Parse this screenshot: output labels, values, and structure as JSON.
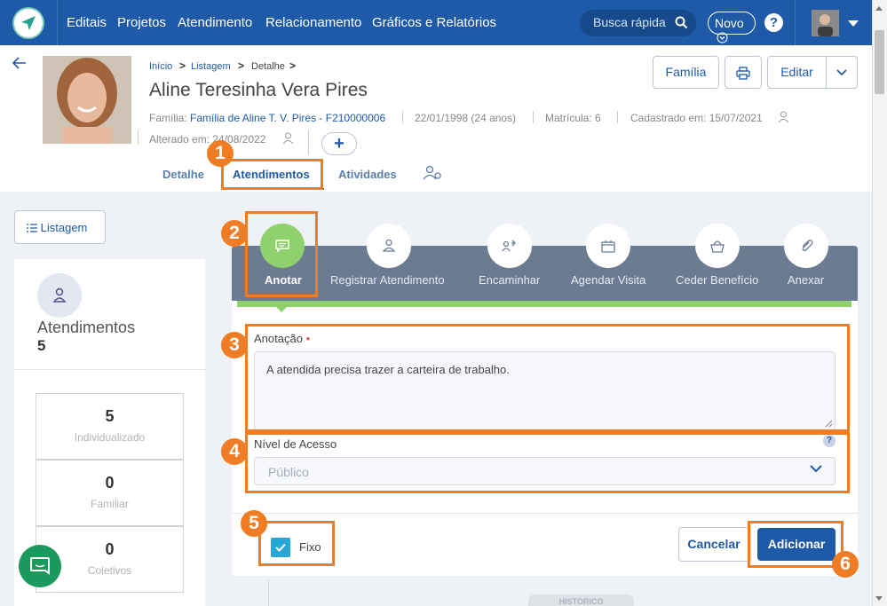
{
  "nav": {
    "items": [
      "Editais",
      "Projetos",
      "Atendimento",
      "Relacionamento",
      "Gráficos e Relatórios"
    ],
    "search_placeholder": "Busca rápida",
    "new_label": "Novo",
    "help_label": "?"
  },
  "breadcrumb": [
    "Início",
    "Listagem",
    "Detalhe"
  ],
  "breadcrumb_sep": ">",
  "person": {
    "name": "Aline Teresinha Vera Pires",
    "familia_label": "Família:",
    "familia_value": "Família de Aline T. V. Pires - F210000006",
    "birth": "22/01/1998 (24 anos)",
    "matricula": "Matrícula: 6",
    "cadastrado": "Cadastrado em: 15/07/2021",
    "alterado": "Alterado em: 24/08/2022"
  },
  "header_buttons": {
    "familia": "Família",
    "editar": "Editar",
    "add": "+"
  },
  "tabs": [
    {
      "label": "Detalhe"
    },
    {
      "label": "Atendimentos",
      "active": true
    },
    {
      "label": "Atividades"
    }
  ],
  "left": {
    "listagem_label": "Listagem",
    "title": "Atendimentos",
    "count": "5",
    "stats": [
      {
        "value": "5",
        "label": "Individualizado"
      },
      {
        "value": "0",
        "label": "Familiar"
      },
      {
        "value": "0",
        "label": "Coletivos"
      }
    ]
  },
  "actions": [
    {
      "label": "Anotar",
      "icon": "note-icon",
      "active": true
    },
    {
      "label": "Registrar Atendimento",
      "icon": "user-icon"
    },
    {
      "label": "Encaminhar",
      "icon": "forward-users-icon"
    },
    {
      "label": "Agendar Visita",
      "icon": "calendar-icon"
    },
    {
      "label": "Ceder Benefício",
      "icon": "basket-icon"
    },
    {
      "label": "Anexar",
      "icon": "paperclip-icon"
    }
  ],
  "form": {
    "anotacao_label": "Anotação",
    "required_mark": "•",
    "anotacao_value": "A atendida precisa trazer a carteira de trabalho.",
    "nivel_label": "Nível de Acesso",
    "nivel_help": "?",
    "nivel_value": "Público",
    "fixo_label": "Fixo",
    "fixo_checked": true,
    "cancel_label": "Cancelar",
    "add_label": "Adicionar",
    "historico_label": "HISTÓRICO"
  },
  "callouts": [
    "1",
    "2",
    "3",
    "4",
    "5",
    "6"
  ],
  "colors": {
    "brand": "#1e5aa8",
    "accent_orange": "#f07d23",
    "active_green": "#8fd16d",
    "checkbox": "#26a7d8",
    "chat": "#1c9a5e"
  }
}
